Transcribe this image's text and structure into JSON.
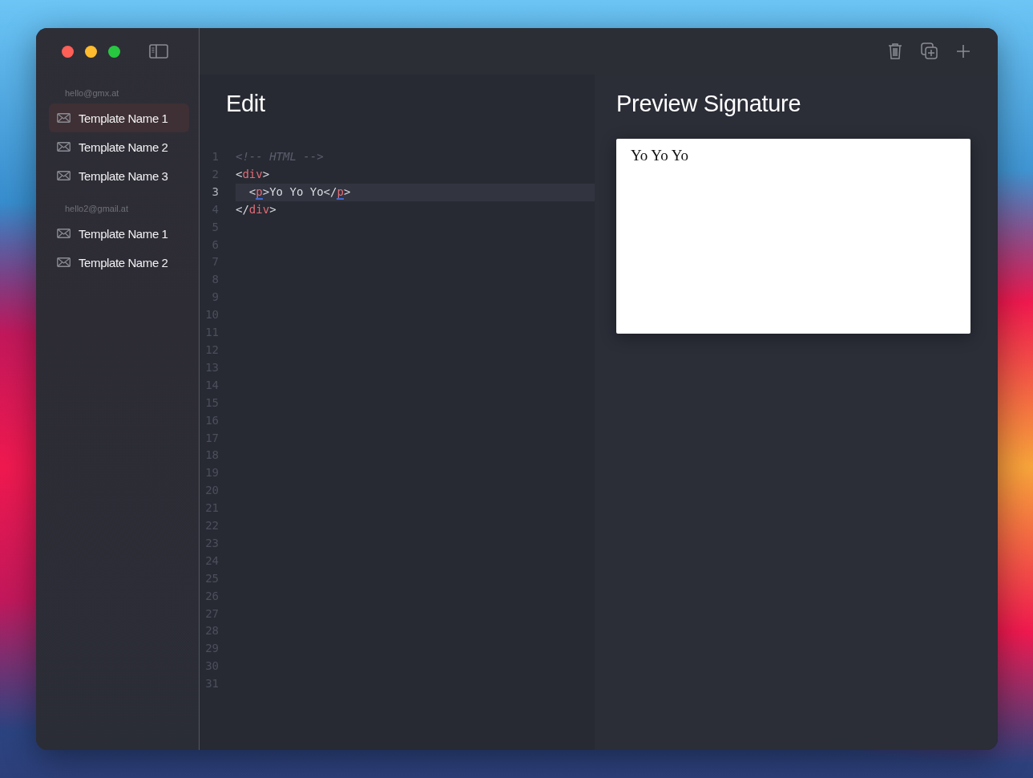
{
  "sidebar": {
    "groups": [
      {
        "account": "hello@gmx.at",
        "items": [
          {
            "label": "Template Name 1",
            "selected": true
          },
          {
            "label": "Template Name 2",
            "selected": false
          },
          {
            "label": "Template Name 3",
            "selected": false
          }
        ]
      },
      {
        "account": "hello2@gmail.at",
        "items": [
          {
            "label": "Template Name 1",
            "selected": false
          },
          {
            "label": "Template Name 2",
            "selected": false
          }
        ]
      }
    ]
  },
  "editor": {
    "title": "Edit",
    "line_numbers": [
      "1",
      "2",
      "3",
      "4",
      "5",
      "6",
      "7",
      "8",
      "9",
      "10",
      "11",
      "12",
      "13",
      "14",
      "15",
      "16",
      "17",
      "18",
      "19",
      "20",
      "21",
      "22",
      "23",
      "24",
      "25",
      "26",
      "27",
      "28",
      "29",
      "30",
      "31"
    ],
    "lines": [
      {
        "current": false,
        "tokens": [
          {
            "kind": "comment",
            "text": "<!-- HTML -->"
          }
        ]
      },
      {
        "current": false,
        "tokens": [
          {
            "kind": "punct",
            "text": "<"
          },
          {
            "kind": "tag",
            "text": "div",
            "matched": false
          },
          {
            "kind": "punct",
            "text": ">"
          }
        ]
      },
      {
        "current": true,
        "tokens": [
          {
            "kind": "punct",
            "text": "  <"
          },
          {
            "kind": "tag",
            "text": "p",
            "matched": true
          },
          {
            "kind": "punct",
            "text": ">"
          },
          {
            "kind": "text",
            "text": "Yo Yo Yo"
          },
          {
            "kind": "punct",
            "text": "</"
          },
          {
            "kind": "tag",
            "text": "p",
            "matched": true
          },
          {
            "kind": "punct",
            "text": ">"
          }
        ]
      },
      {
        "current": false,
        "tokens": [
          {
            "kind": "punct",
            "text": "</"
          },
          {
            "kind": "tag",
            "text": "div",
            "matched": false
          },
          {
            "kind": "punct",
            "text": ">"
          }
        ]
      }
    ]
  },
  "preview": {
    "title": "Preview Signature",
    "content": "Yo Yo Yo"
  }
}
